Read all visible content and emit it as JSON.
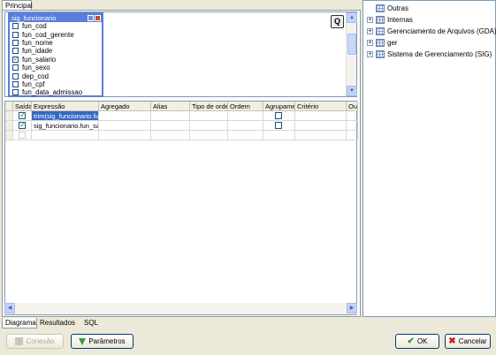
{
  "tabs": {
    "principal": "Principal"
  },
  "table_window": {
    "title": "sig_funcionario",
    "fields": [
      {
        "name": "fun_cod",
        "checked": false
      },
      {
        "name": "fun_cod_gerente",
        "checked": false
      },
      {
        "name": "fun_nome",
        "checked": false
      },
      {
        "name": "fun_idade",
        "checked": false
      },
      {
        "name": "fun_salario",
        "checked": true
      },
      {
        "name": "fun_sexo",
        "checked": false
      },
      {
        "name": "dep_cod",
        "checked": false
      },
      {
        "name": "fun_cpf",
        "checked": false
      },
      {
        "name": "fun_data_admissao",
        "checked": false
      }
    ]
  },
  "zoom_button": "Q",
  "grid": {
    "columns": [
      "Saída",
      "Expressão",
      "Agregado",
      "Alias",
      "Tipo de ordem",
      "Ordem",
      "Agrupamento",
      "Critério",
      "Ou"
    ],
    "rows": [
      {
        "saida": true,
        "expressao": "trim(sig_funcionario.fun_salario)",
        "agrupamento": false
      },
      {
        "saida": true,
        "expressao": "sig_funcionario.fun_salario",
        "agrupamento": false
      },
      {
        "saida": false,
        "expressao": "",
        "agrupamento": null
      }
    ]
  },
  "bottom_tabs": {
    "diagrama": "Diagrama",
    "resultados": "Resultados",
    "sql": "SQL"
  },
  "tree": [
    {
      "label": "Outras"
    },
    {
      "label": "Internas"
    },
    {
      "label": "Gerenciamento de Arquivos (GDA)"
    },
    {
      "label": "ger"
    },
    {
      "label": "Sistema de Gerenciamento (SIG)"
    }
  ],
  "buttons": {
    "conexao": "Conexão",
    "parametros": "Parâmetros",
    "ok": "OK",
    "cancelar": "Cancelar"
  },
  "colors": {
    "selection": "#316ac5",
    "titlebar": "#5a7edc",
    "ok_icon": "#2a9a2a",
    "cancel_icon": "#c82020"
  }
}
